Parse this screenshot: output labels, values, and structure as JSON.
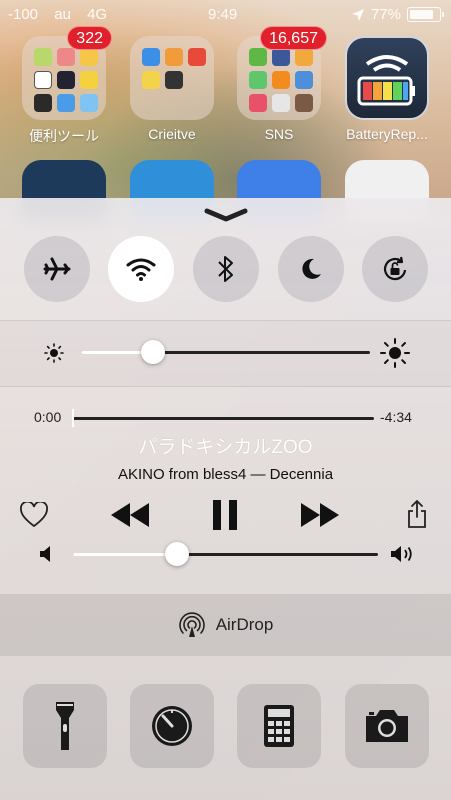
{
  "status_bar": {
    "signal": "-100",
    "carrier": "au",
    "network": "4G",
    "time": "9:49",
    "battery_percent": "77%",
    "battery_level": 0.77
  },
  "home_screen": {
    "apps": [
      {
        "label": "便利ツール",
        "badge": "322"
      },
      {
        "label": "Crieitve",
        "badge": ""
      },
      {
        "label": "SNS",
        "badge": "16,657"
      },
      {
        "label": "BatteryRep...",
        "badge": ""
      }
    ]
  },
  "control_center": {
    "toggles": [
      {
        "name": "airplane",
        "icon": "airplane-icon",
        "on": false
      },
      {
        "name": "wifi",
        "icon": "wifi-icon",
        "on": true
      },
      {
        "name": "bluetooth",
        "icon": "bluetooth-icon",
        "on": false
      },
      {
        "name": "do-not-disturb",
        "icon": "moon-icon",
        "on": false
      },
      {
        "name": "rotation-lock",
        "icon": "rotation-lock-icon",
        "on": false
      }
    ],
    "brightness_level": 0.25,
    "music": {
      "elapsed": "0:00",
      "remaining": "-4:34",
      "progress": 0.0,
      "title": "パラドキシカルZOO",
      "artist_album": "AKINO from bless4 — Decennia"
    },
    "volume_level": 0.34,
    "airdrop_label": "AirDrop",
    "tools": [
      {
        "name": "flashlight",
        "icon": "flashlight-icon"
      },
      {
        "name": "timer",
        "icon": "timer-icon"
      },
      {
        "name": "calculator",
        "icon": "calculator-icon"
      },
      {
        "name": "camera",
        "icon": "camera-icon"
      }
    ]
  }
}
